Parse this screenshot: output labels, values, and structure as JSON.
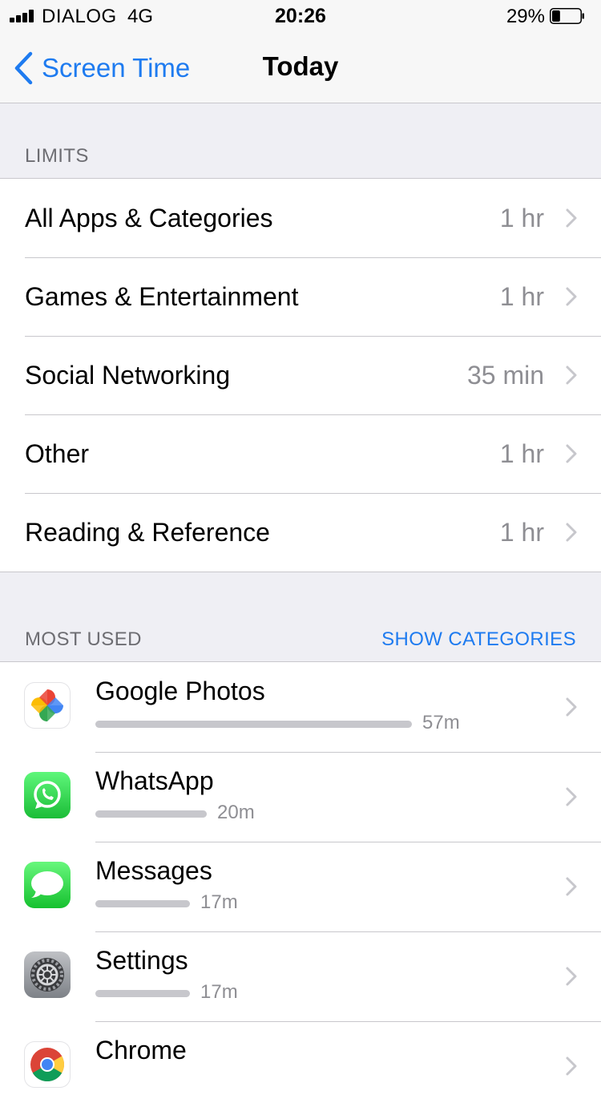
{
  "status_bar": {
    "carrier": "DIALOG",
    "network": "4G",
    "time": "20:26",
    "battery": "29%",
    "battery_level": 0.29
  },
  "nav": {
    "back_label": "Screen Time",
    "title": "Today"
  },
  "limits": {
    "header": "LIMITS",
    "items": [
      {
        "label": "All Apps & Categories",
        "value": "1 hr"
      },
      {
        "label": "Games & Entertainment",
        "value": "1 hr"
      },
      {
        "label": "Social Networking",
        "value": "35 min"
      },
      {
        "label": "Other",
        "value": "1 hr"
      },
      {
        "label": "Reading & Reference",
        "value": "1 hr"
      }
    ]
  },
  "most_used": {
    "header": "MOST USED",
    "action": "SHOW CATEGORIES",
    "apps": [
      {
        "name": "Google Photos",
        "time": "57m",
        "minutes": 57,
        "icon": "google-photos-icon"
      },
      {
        "name": "WhatsApp",
        "time": "20m",
        "minutes": 20,
        "icon": "whatsapp-icon"
      },
      {
        "name": "Messages",
        "time": "17m",
        "minutes": 17,
        "icon": "messages-icon"
      },
      {
        "name": "Settings",
        "time": "17m",
        "minutes": 17,
        "icon": "settings-icon"
      },
      {
        "name": "Chrome",
        "time": "",
        "minutes": null,
        "icon": "chrome-icon"
      }
    ]
  },
  "colors": {
    "accent": "#1e7bf0",
    "background": "#efeff4",
    "secondary_text": "#8e8e93"
  }
}
